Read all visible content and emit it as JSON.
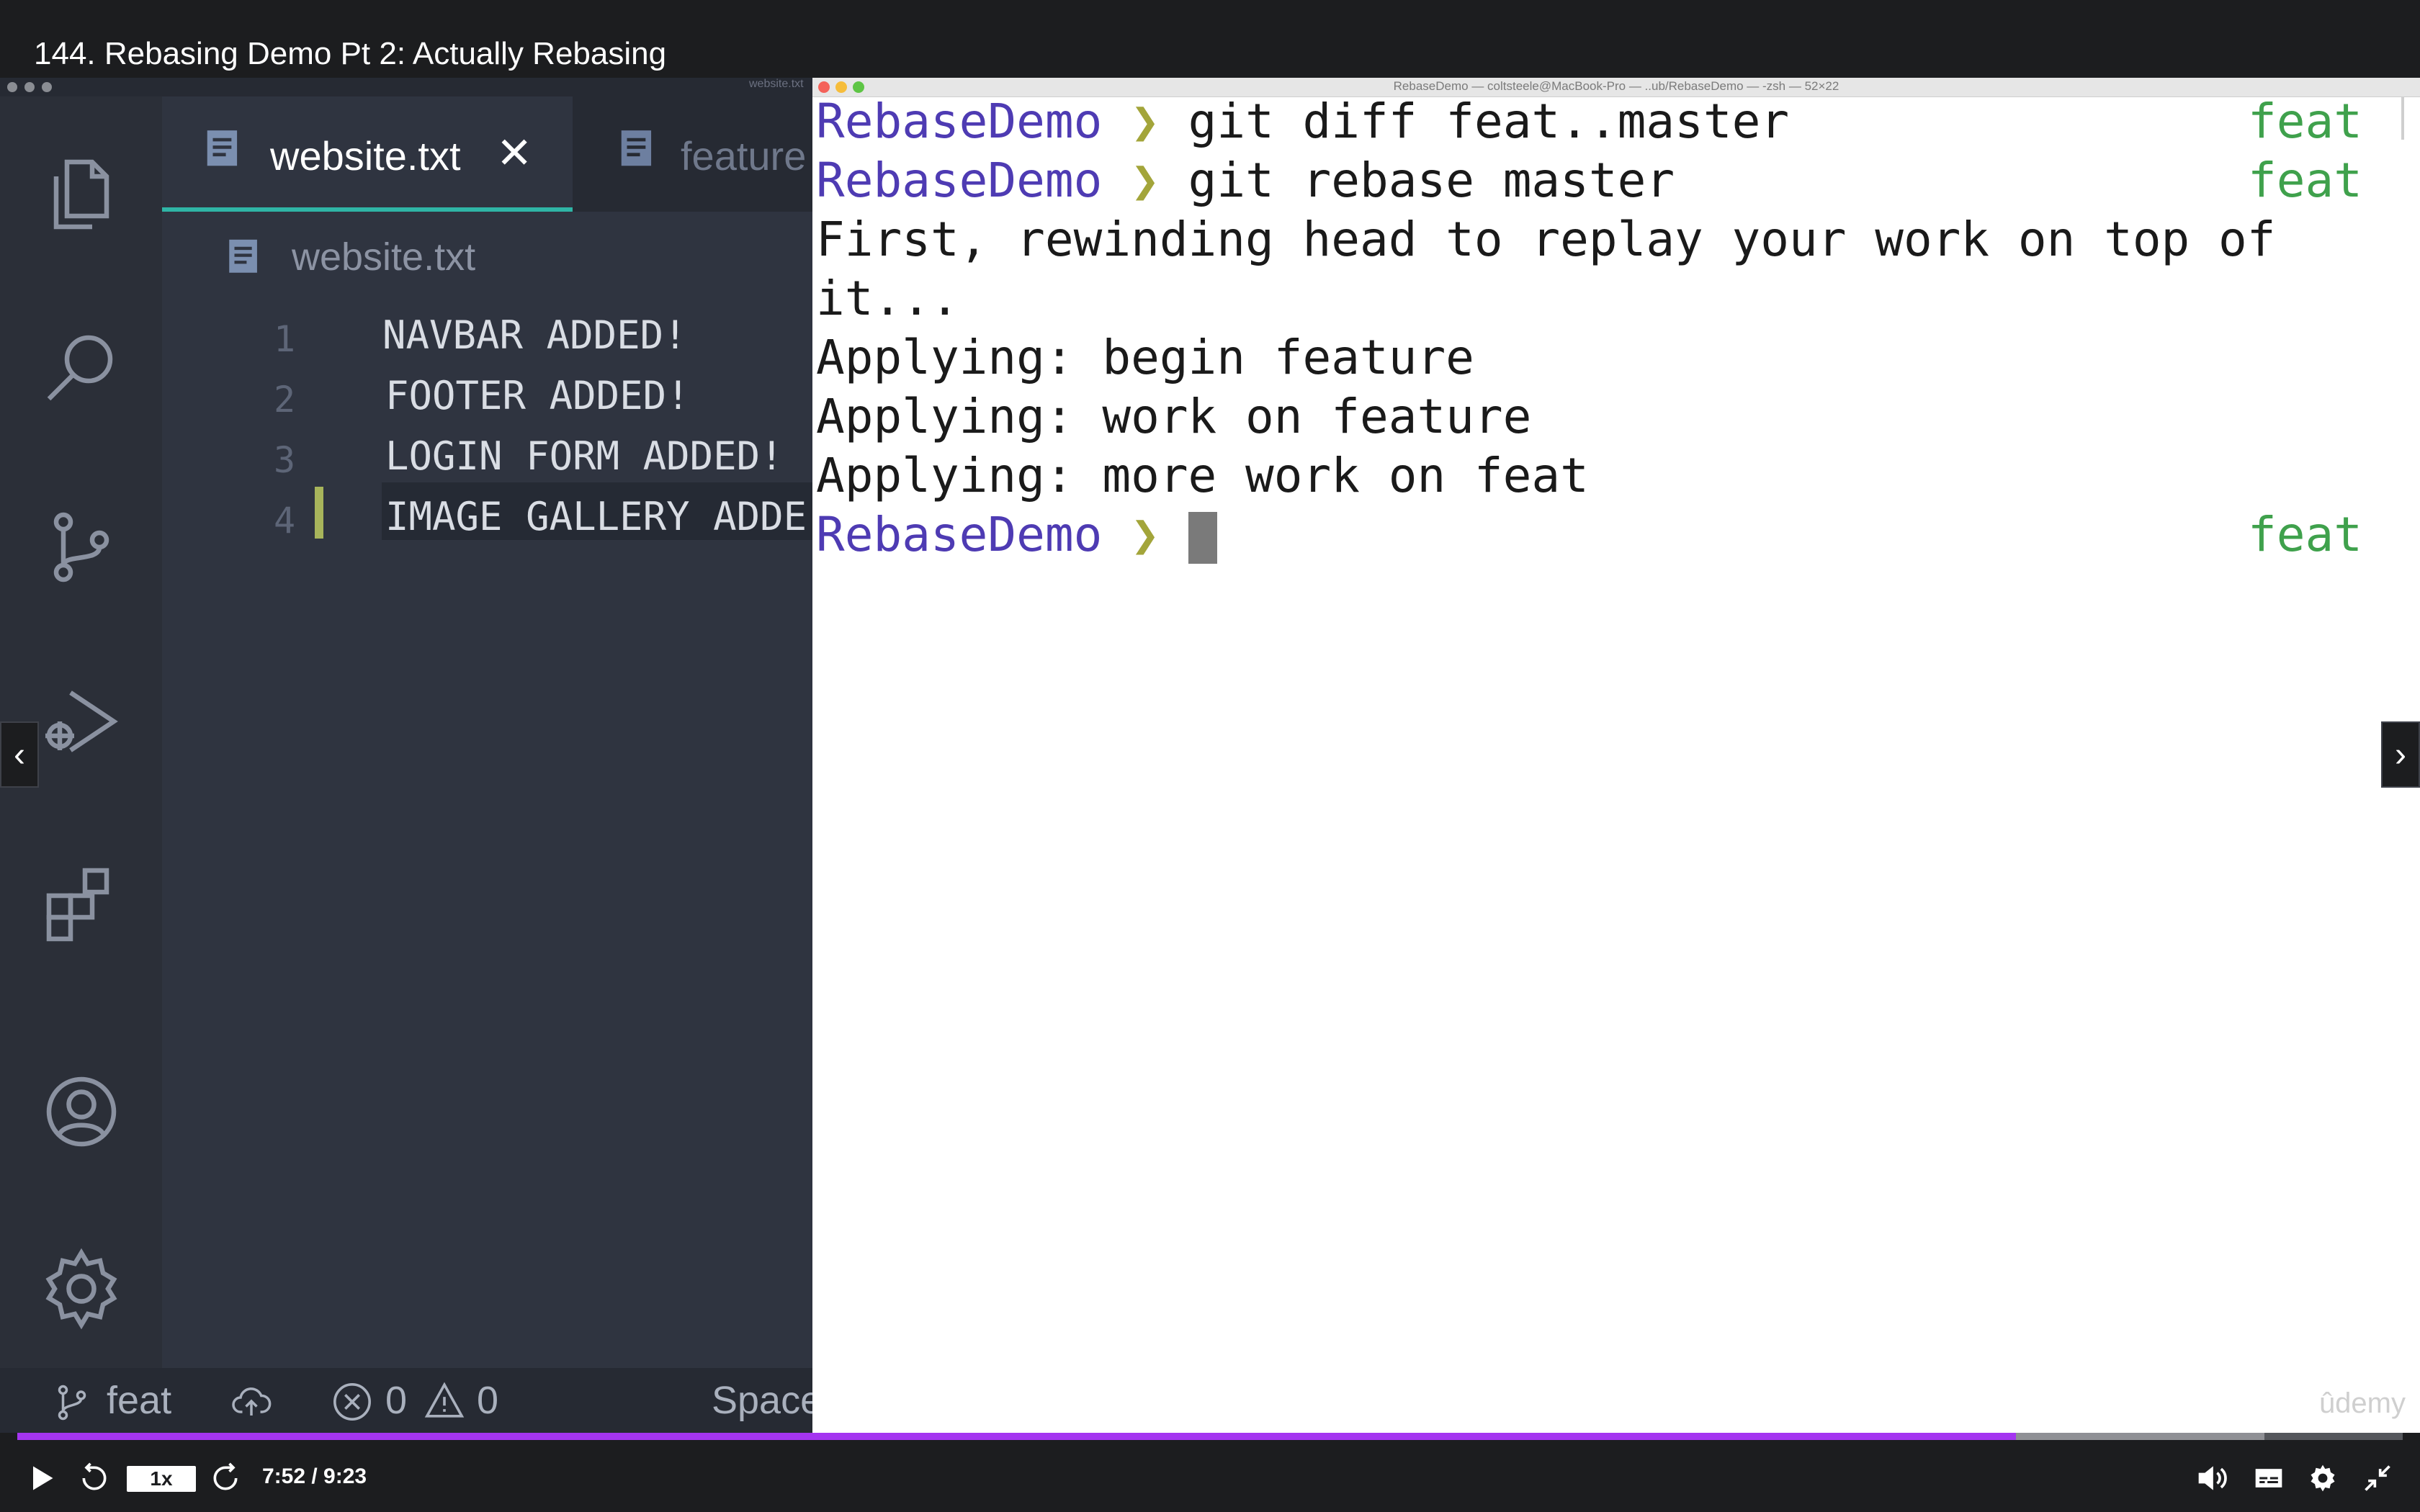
{
  "video": {
    "title": "144. Rebasing Demo Pt 2: Actually Rebasing",
    "time": "7:52 / 9:23",
    "speed": "1x",
    "progress_percent": 83.8,
    "buffered_percent": 94.2,
    "watermark": "ûdemy"
  },
  "vscode": {
    "tabs": [
      {
        "label": "website.txt",
        "icon": "file-lines-icon",
        "active": true
      },
      {
        "label": "feature",
        "icon": "file-lines-icon",
        "active": false
      }
    ],
    "breadcrumb": "website.txt",
    "tiny_title": "website.txt",
    "lines": [
      {
        "num": "1",
        "text": "NAVBAR ADDED!"
      },
      {
        "num": "2",
        "text": "FOOTER ADDED!"
      },
      {
        "num": "3",
        "text": "LOGIN FORM ADDED!"
      },
      {
        "num": "4",
        "text": "IMAGE GALLERY ADDE"
      }
    ],
    "status": {
      "branch": "feat",
      "errors": "0",
      "warnings": "0",
      "spaces": "Space"
    },
    "activity_icons": [
      "files-icon",
      "search-icon",
      "source-control-icon",
      "run-debug-icon",
      "extensions-icon",
      "account-icon",
      "settings-gear-icon"
    ]
  },
  "terminal": {
    "title": "RebaseDemo — coltsteele@MacBook-Pro — ..ub/RebaseDemo — -zsh — 52×22",
    "prompt_dir": "RebaseDemo",
    "prompt_arrow": "❯",
    "branch": "feat",
    "lines": [
      {
        "type": "prompt",
        "cmd": "git diff feat..master"
      },
      {
        "type": "prompt",
        "cmd": "git rebase master"
      },
      {
        "type": "output",
        "text": "First, rewinding head to replay your work on top of"
      },
      {
        "type": "output",
        "text": "it..."
      },
      {
        "type": "output",
        "text": "Applying: begin feature"
      },
      {
        "type": "output",
        "text": "Applying: work on feature"
      },
      {
        "type": "output",
        "text": "Applying: more work on feat"
      },
      {
        "type": "prompt",
        "cmd": ""
      }
    ]
  },
  "colors": {
    "accent": "#a435f0",
    "prompt_dir": "#4e3bb3",
    "branch": "#3fa14c"
  }
}
